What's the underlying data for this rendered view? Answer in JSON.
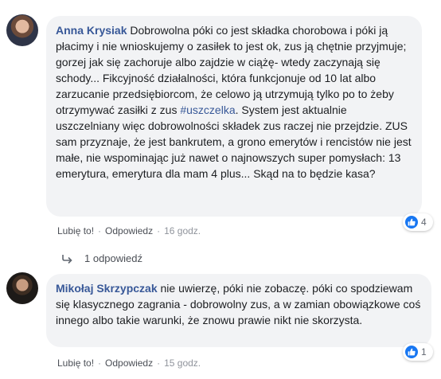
{
  "comments": [
    {
      "author": "Anna Krysiak",
      "text_before": "Dobrowolna póki co jest składka chorobowa i póki ją płacimy i nie wnioskujemy o zasiłek to jest ok, zus ją chętnie przyjmuje; gorzej jak się zachoruje albo zajdzie w ciążę- wtedy zaczynają się schody... Fikcyjność działalności, która funkcjonuje od 10 lat albo zarzucanie przedsiębiorcom, że celowo ją utrzymują tylko po to żeby otrzymywać zasiłki z zus ",
      "hashtag": "#uszczelka",
      "text_after": ". System jest aktualnie uszczelniany więc dobrowolności składek zus raczej nie przejdzie. ZUS sam przyznaje, że jest bankrutem, a grono emerytów i rencistów nie jest małe, nie wspominając już nawet o najnowszych super pomysłach: 13 emerytura, emerytura dla mam 4 plus... Skąd na to będzie kasa?",
      "reaction_count": "4",
      "like_label": "Lubię to!",
      "reply_label": "Odpowiedz",
      "sep": "·",
      "time": "16 godz.",
      "replies_label": "1 odpowiedź",
      "reaction_icon": "thumbs-up-icon",
      "accent": "#385898"
    },
    {
      "author": "Mikołaj Skrzypczak",
      "text": "nie uwierzę, póki nie zobaczę. póki co spodziewam się klasycznego zagrania - dobrowolny zus, a w zamian obowiązkowe coś innego albo takie warunki, że znowu prawie nikt nie skorzysta.",
      "reaction_count": "1",
      "like_label": "Lubię to!",
      "reply_label": "Odpowiedz",
      "sep": "·",
      "time": "15 godz.",
      "reaction_icon": "thumbs-up-icon"
    }
  ],
  "colors": {
    "link": "#385898",
    "bubble": "#f2f3f5",
    "like_blue": "#1877f2"
  }
}
